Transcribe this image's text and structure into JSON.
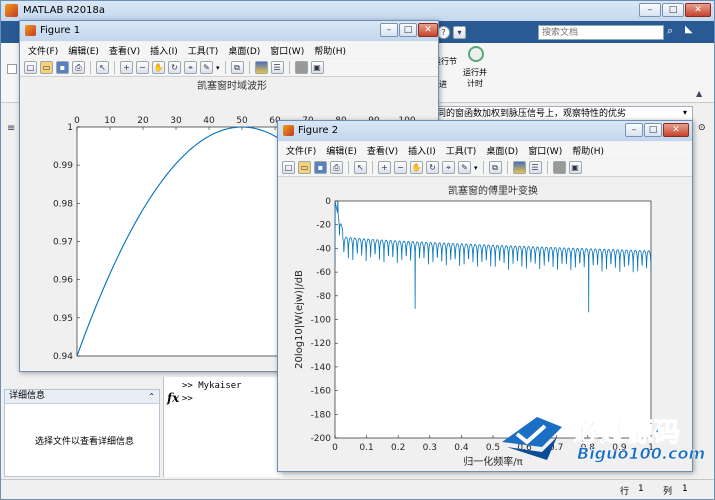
{
  "main": {
    "title": "MATLAB R2018a",
    "search_placeholder": "搜索文档",
    "ribbon_run_section": "运行节",
    "ribbon_run_advance": "运行并\n计时",
    "ribbon_advance": "进",
    "hint_text": "同的窗函数加权到脉压信号上，观察特性的优劣",
    "details_panel_title": "详细信息",
    "details_panel_empty": "选择文件以查看详细信息",
    "command_line1": ">> Mykaiser",
    "command_prompt": ">>",
    "fx_symbol": "fx",
    "status_row_label": "行",
    "status_row_value": "1",
    "status_col_label": "列",
    "status_col_value": "1"
  },
  "menu_labels": [
    "文件(F)",
    "编辑(E)",
    "查看(V)",
    "插入(I)",
    "工具(T)",
    "桌面(D)",
    "窗口(W)",
    "帮助(H)"
  ],
  "figure1": {
    "title": "Figure 1",
    "chart_data": {
      "type": "line",
      "title": "凯塞窗时域波形",
      "x_ticks": [
        "0",
        "10",
        "20",
        "30",
        "40",
        "50",
        "60",
        "70",
        "80",
        "90",
        "100"
      ],
      "y_ticks": [
        "1",
        "0.99",
        "0.98",
        "0.97",
        "0.96",
        "0.95",
        "0.94"
      ],
      "xlim": [
        0,
        100
      ],
      "ylim": [
        0.94,
        1
      ],
      "x_axis_location": "top",
      "series": [
        {
          "shape": "kaiser window, rises from 0.94 at n=0 to 1 at n=50",
          "x": [
            0,
            5,
            10,
            15,
            20,
            25,
            30,
            35,
            40,
            45,
            50
          ],
          "y": [
            0.94,
            0.9514,
            0.9618,
            0.9707,
            0.9784,
            0.985,
            0.9904,
            0.9946,
            0.9976,
            0.9994,
            1.0
          ]
        }
      ]
    }
  },
  "figure2": {
    "title": "Figure 2",
    "chart_data": {
      "type": "line",
      "title": "凯塞窗的傅里叶变换",
      "xlabel": "归一化频率/π",
      "ylabel": "20log10|W(ejw)|/dB",
      "x_ticks": [
        "0",
        "0.1",
        "0.2",
        "0.3",
        "0.4",
        "0.5",
        "0.6",
        "0.7",
        "0.8",
        "0.9",
        "1"
      ],
      "y_ticks": [
        "0",
        "-20",
        "-40",
        "-60",
        "-80",
        "-100",
        "-120",
        "-140",
        "-160",
        "-180",
        "-200"
      ],
      "xlim": [
        0,
        1
      ],
      "ylim": [
        -200,
        0
      ],
      "grid": false,
      "series": [
        {
          "shape": "main lobe at 0 dB, sidelobes decaying from about -30 dB to -42 dB with periodic nulls",
          "x": [
            0,
            0.02,
            0.05,
            0.1,
            0.2,
            0.3,
            0.4,
            0.5,
            0.6,
            0.7,
            0.8,
            0.9,
            1.0
          ],
          "y": [
            0,
            -25,
            -30,
            -32,
            -35,
            -37,
            -38,
            -39,
            -40,
            -40,
            -41,
            -41,
            -42
          ]
        }
      ]
    }
  },
  "watermark": {
    "brand_text": "必过源码",
    "brand_url": "Biguo100.com"
  }
}
